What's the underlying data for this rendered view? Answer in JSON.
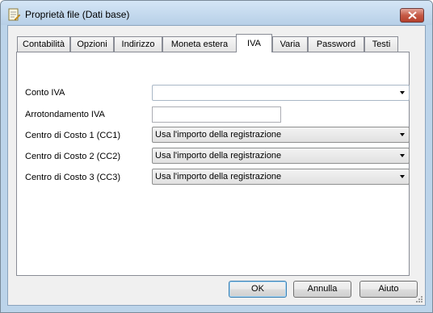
{
  "window": {
    "title": "Proprietà file (Dati base)",
    "icon": "file-properties-icon",
    "close_icon": "close-icon"
  },
  "tabs": [
    {
      "label": "Contabilità"
    },
    {
      "label": "Opzioni"
    },
    {
      "label": "Indirizzo"
    },
    {
      "label": "Moneta estera"
    },
    {
      "label": "IVA",
      "active": true
    },
    {
      "label": "Varia"
    },
    {
      "label": "Password"
    },
    {
      "label": "Testi"
    }
  ],
  "form": {
    "conto_iva": {
      "label": "Conto IVA",
      "value": ""
    },
    "arrotondamento": {
      "label": "Arrotondamento IVA",
      "value": ""
    },
    "cc1": {
      "label": "Centro di Costo 1 (CC1)",
      "value": "Usa l'importo della registrazione"
    },
    "cc2": {
      "label": "Centro di Costo 2 (CC2)",
      "value": "Usa l'importo della registrazione"
    },
    "cc3": {
      "label": "Centro di Costo 3 (CC3)",
      "value": "Usa l'importo della registrazione"
    }
  },
  "buttons": {
    "ok": "OK",
    "cancel": "Annulla",
    "help": "Aiuto"
  }
}
